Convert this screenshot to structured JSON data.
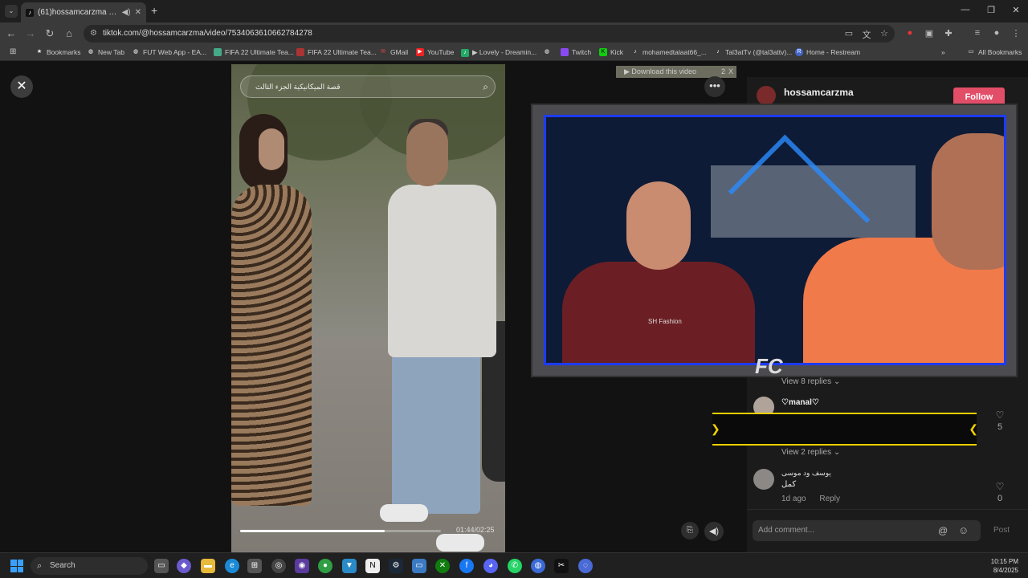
{
  "browser": {
    "tab_title": "(61)hossamcarzma (@hossa",
    "url": "tiktok.com/@hossamcarzma/video/7534063610662784278",
    "bookmarks": [
      {
        "label": "Bookmarks",
        "icon": "star-icon"
      },
      {
        "label": "New Tab",
        "icon": "globe-icon"
      },
      {
        "label": "FUT Web App - EA...",
        "icon": "globe-icon"
      },
      {
        "label": "FIFA 22 Ultimate Tea...",
        "icon": "fifa-icon"
      },
      {
        "label": "FIFA 22 Ultimate Tea...",
        "icon": "fifa-icon"
      },
      {
        "label": "GMail",
        "icon": "gmail-icon"
      },
      {
        "label": "YouTube",
        "icon": "youtube-icon"
      },
      {
        "label": "▶ Lovely - Dreamin...",
        "icon": "music-icon"
      },
      {
        "label": "",
        "icon": "globe-icon"
      },
      {
        "label": "Twitch",
        "icon": "twitch-icon"
      },
      {
        "label": "Kick",
        "icon": "kick-icon"
      },
      {
        "label": "mohamedtalaat66_...",
        "icon": "tiktok-icon"
      },
      {
        "label": "Tal3atTv (@tal3attv)...",
        "icon": "tiktok-icon"
      },
      {
        "label": "Home - Restream",
        "icon": "restream-icon"
      }
    ],
    "all_bookmarks": "All Bookmarks"
  },
  "video": {
    "search_text": "قصة الميكانيكية الجزء الثالث",
    "time": "01:44/02:25",
    "progress": 0.72
  },
  "download_banner": {
    "label": "▶ Download this video",
    "count": "2",
    "close": "X"
  },
  "profile": {
    "username": "hossamcarzma",
    "follow_label": "Follow"
  },
  "stream_overlay": {
    "shirt_text": "SH Fashion",
    "logo": "FC"
  },
  "comments": {
    "view_replies_1": "View 8 replies ⌄",
    "comment1_name": "♡manal♡",
    "comment1_likes": "5",
    "view_replies_2": "View 2 replies ⌄",
    "comment2_name": "يوسف ود موسى",
    "comment2_text": "كمل",
    "comment2_time": "1d ago",
    "comment2_reply": "Reply",
    "comment2_likes": "0"
  },
  "comment_bar": {
    "placeholder": "Add comment...",
    "post_label": "Post"
  },
  "taskbar": {
    "search_label": "Search",
    "time": "10:15 PM",
    "date": "8/4/2025"
  }
}
